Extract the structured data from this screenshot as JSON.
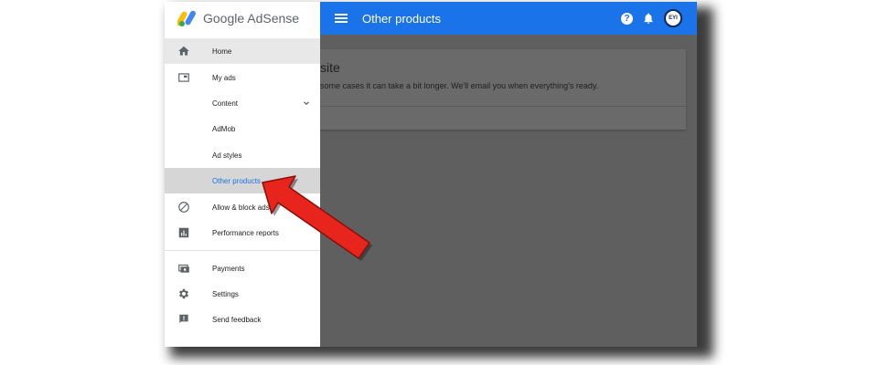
{
  "app": {
    "brand": "Google AdSense",
    "page_title": "Other products",
    "avatar_initials": "EYI"
  },
  "card": {
    "title": "site",
    "text": "some cases it can take a bit longer. We'll email you when everything's ready."
  },
  "sidebar": {
    "items": [
      {
        "label": "Home",
        "icon": "home-icon"
      },
      {
        "label": "My ads",
        "icon": "my-ads-icon"
      },
      {
        "label": "Content",
        "icon": "",
        "expandable": true
      },
      {
        "label": "AdMob",
        "icon": ""
      },
      {
        "label": "Ad styles",
        "icon": ""
      },
      {
        "label": "Other products",
        "icon": "",
        "selected": true
      },
      {
        "label": "Allow & block ads",
        "icon": "block-icon"
      },
      {
        "label": "Performance reports",
        "icon": "bar-chart-icon"
      },
      {
        "label": "Payments",
        "icon": "payments-icon"
      },
      {
        "label": "Settings",
        "icon": "gear-icon"
      },
      {
        "label": "Send feedback",
        "icon": "feedback-icon"
      }
    ]
  },
  "colors": {
    "topbar": "#1a73e8",
    "overlay": "#5f5f5f",
    "arrow": "#e8251c",
    "selected_text": "#1a73e8"
  }
}
